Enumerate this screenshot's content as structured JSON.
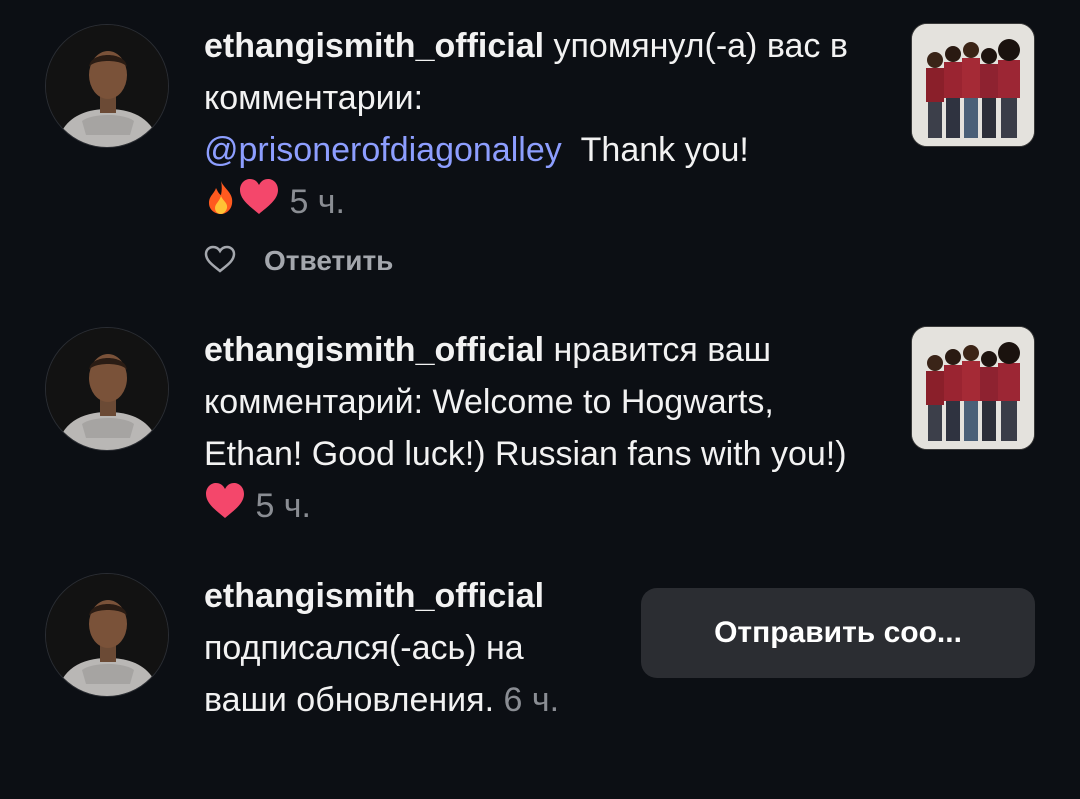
{
  "notifications": [
    {
      "username": "ethangismith_official",
      "action": "упомянул(-а) вас в комментарии:",
      "mention": "@prisonerofdiagonalley",
      "comment": "Thank you!",
      "emojis": [
        "fire-emoji",
        "heart-emoji"
      ],
      "time": "5 ч.",
      "reply_label": "Ответить",
      "has_post_thumbnail": true
    },
    {
      "username": "ethangismith_official",
      "action": "нравится ваш комментарий: Welcome to Hogwarts, Ethan! Good luck!) Russian fans with you!)",
      "emojis": [
        "heart-emoji"
      ],
      "time": "5 ч.",
      "has_post_thumbnail": true
    },
    {
      "username": "ethangismith_official",
      "action": "подписался(-ась) на ваши обновления.",
      "time_num": "6",
      "time_unit": "ч.",
      "button_label": "Отправить соо..."
    }
  ],
  "colors": {
    "background": "#0c0f14",
    "mention": "#8d9eff",
    "muted": "#8a8d93",
    "button_bg": "#2b2d32"
  }
}
